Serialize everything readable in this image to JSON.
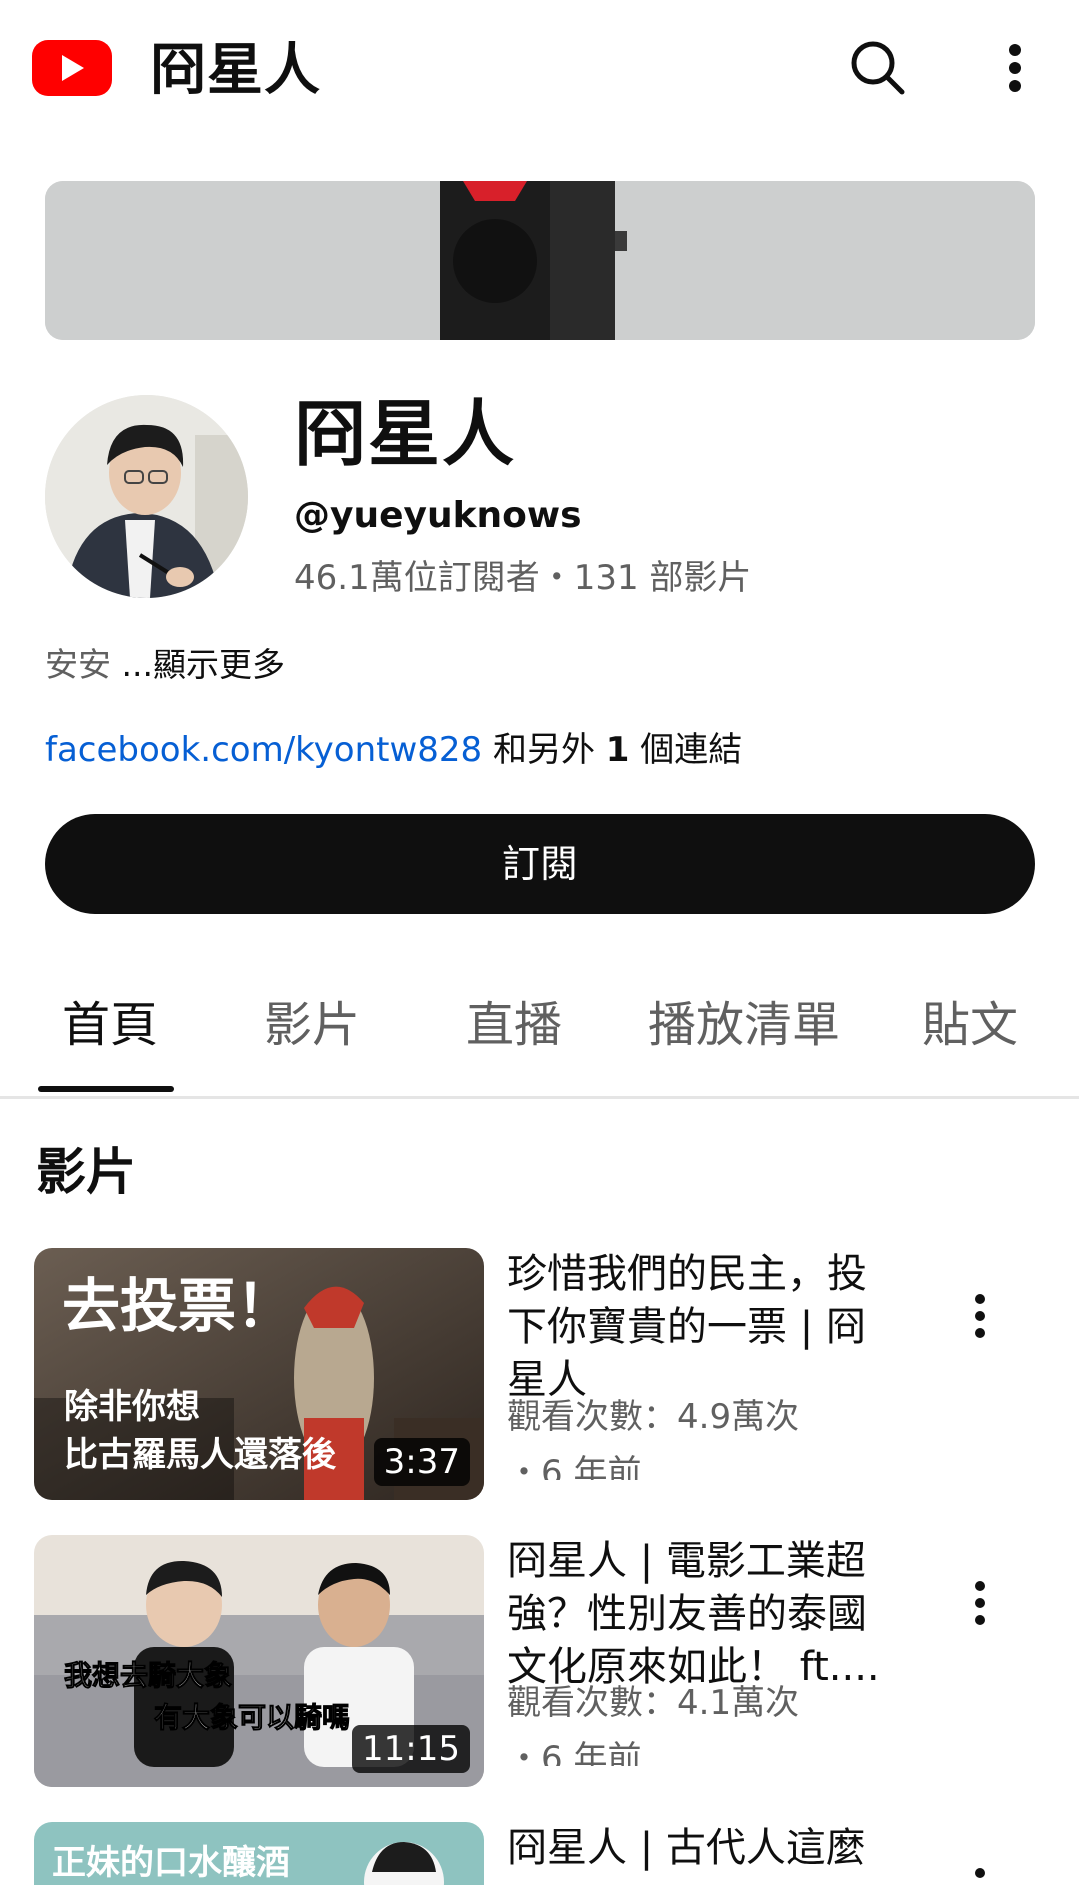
{
  "header": {
    "title": "冏星人",
    "icons": [
      "youtube-logo",
      "search-icon",
      "more-vert-icon"
    ]
  },
  "channel": {
    "name": "冏星人",
    "handle": "@yueyuknows",
    "stats": "46.1萬位訂閱者・131 部影片",
    "description": "安安",
    "show_more": "...顯示更多",
    "link_text": "facebook.com/kyontw828",
    "link_suffix_pre": " 和另外 ",
    "link_count": "1",
    "link_suffix_post": " 個連結",
    "subscribe_label": "訂閱"
  },
  "tabs": [
    "首頁",
    "影片",
    "直播",
    "播放清單",
    "貼文"
  ],
  "active_tab": 0,
  "section_title": "影片",
  "videos": [
    {
      "title": "珍惜我們的民主，投下你寶貴的一票 | 冏星人",
      "views": "觀看次數：4.9萬次",
      "age": "・6 年前",
      "duration": "3:37",
      "thumb_text_1": "去投票！",
      "thumb_text_2": "除非你想",
      "thumb_text_3": "比古羅馬人還落後"
    },
    {
      "title": "冏星人 | 電影工業超強？性別友善的泰國文化原來如此！ ft....",
      "views": "觀看次數：4.1萬次",
      "age": "・6 年前",
      "duration": "11:15",
      "thumb_text_1": "我想去騎大象",
      "thumb_text_2": "有大象可以騎嗎"
    },
    {
      "title": "冏星人 | 古代人這麼",
      "thumb_text_1": "正妹的口水釀酒"
    }
  ]
}
